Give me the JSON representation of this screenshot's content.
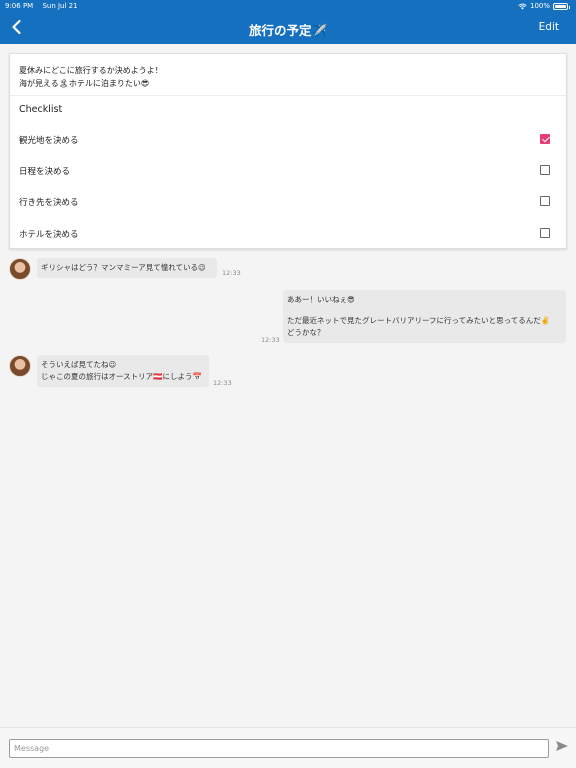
{
  "status_bar": {
    "time": "9:06 PM",
    "date": "Sun Jul 21",
    "battery": "100%"
  },
  "nav": {
    "title": "旅行の予定✈️",
    "edit_label": "Edit"
  },
  "card": {
    "description": [
      "夏休みにどこに旅行するか決めようよ！",
      "海が見える🏝ホテルに泊まりたい😎"
    ],
    "checklist_title": "Checklist",
    "items": [
      {
        "label": "観光地を決める",
        "checked": true
      },
      {
        "label": "日程を決める",
        "checked": false
      },
      {
        "label": "行き先を決める",
        "checked": false
      },
      {
        "label": "ホテルを決める",
        "checked": false
      }
    ]
  },
  "messages": [
    {
      "side": "left",
      "lines": [
        "ギリシャはどう？マンマミーア見て憧れている😉"
      ],
      "time": "12:33"
    },
    {
      "side": "right",
      "lines": [
        "ああー！いいねぇ😎",
        "",
        "ただ最近ネットで見たグレートバリアリーフに行ってみたいと思ってるんだ✌️",
        "どうかな？"
      ],
      "time": "12:33"
    },
    {
      "side": "left",
      "lines": [
        "そういえば見てたね😉",
        "じゃこの夏の旅行はオーストリア🇦🇹にしよう📅"
      ],
      "time": "12:33"
    }
  ],
  "composer": {
    "placeholder": "Message"
  },
  "colors": {
    "nav_bar": "#1670c0",
    "checkbox_checked": "#e63f73",
    "bubble": "#e9e9e9"
  },
  "icons": {
    "back": "chevron-left-icon",
    "send": "send-icon",
    "wifi": "wifi-icon",
    "battery": "battery-icon"
  }
}
